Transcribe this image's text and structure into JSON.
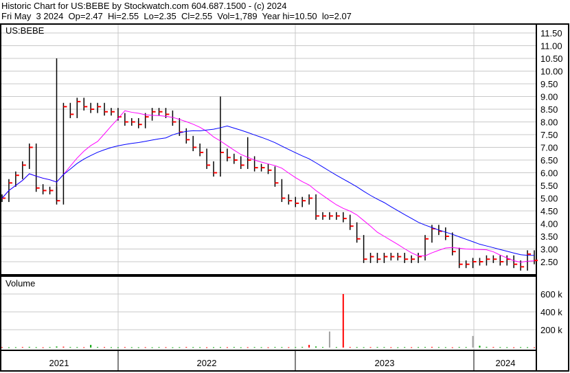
{
  "header": {
    "title": "Historic Chart for US:BEBE by Stockwatch.com 604.687.1500 - (c) 2024",
    "quote": "Fri May  3 2024  Op=2.47  Hi=2.55  Lo=2.35  Cl=2.55  Vol=1,789  Year hi=10.50  lo=2.07"
  },
  "chart_data": {
    "type": "line",
    "symbol": "US:BEBE",
    "volume_label": "Volume",
    "price_ticks": [
      "2.50",
      "3.00",
      "3.50",
      "4.00",
      "4.50",
      "5.00",
      "5.50",
      "6.00",
      "6.50",
      "7.00",
      "7.50",
      "8.00",
      "8.50",
      "9.00",
      "9.50",
      "10.00",
      "10.50",
      "11.00",
      "11.50"
    ],
    "volume_ticks": [
      "200 k",
      "400 k",
      "600 k"
    ],
    "years": [
      "2021",
      "2022",
      "2023",
      "2024"
    ],
    "ylim": [
      2.5,
      11.5
    ],
    "closes": [
      5.0,
      5.6,
      5.9,
      6.3,
      7.0,
      5.4,
      5.3,
      5.3,
      4.9,
      8.6,
      8.3,
      8.8,
      8.6,
      8.5,
      8.6,
      8.4,
      8.4,
      8.2,
      8.0,
      8.0,
      7.9,
      8.2,
      8.4,
      8.4,
      8.3,
      8.0,
      7.6,
      7.3,
      7.0,
      6.8,
      6.3,
      6.0,
      6.8,
      6.6,
      6.5,
      6.3,
      6.5,
      6.2,
      6.2,
      6.1,
      5.6,
      5.0,
      4.9,
      4.8,
      4.9,
      5.0,
      4.3,
      4.3,
      4.3,
      4.3,
      4.2,
      3.9,
      3.4,
      2.6,
      2.7,
      2.6,
      2.7,
      2.7,
      2.7,
      2.6,
      2.6,
      2.7,
      3.4,
      3.8,
      3.7,
      3.5,
      2.9,
      2.4,
      2.4,
      2.5,
      2.5,
      2.6,
      2.6,
      2.5,
      2.6,
      2.4,
      2.3,
      2.8,
      2.55
    ],
    "spikes": [
      {
        "i": 8,
        "high": 10.5
      },
      {
        "i": 32,
        "high": 9.0
      },
      {
        "i": 36,
        "high": 7.4
      }
    ],
    "volume_k": [
      5,
      3,
      4,
      6,
      8,
      4,
      3,
      5,
      12,
      10,
      6,
      5,
      4,
      30,
      6,
      5,
      4,
      3,
      5,
      4,
      3,
      4,
      3,
      5,
      4,
      3,
      4,
      6,
      5,
      4,
      3,
      4,
      5,
      4,
      6,
      3,
      4,
      5,
      4,
      3,
      6,
      5,
      4,
      5,
      8,
      30,
      12,
      6,
      180,
      5,
      600,
      6,
      5,
      4,
      5,
      6,
      5,
      4,
      3,
      5,
      4,
      5,
      6,
      8,
      5,
      4,
      3,
      6,
      5,
      130,
      20,
      8,
      6,
      5,
      4,
      3,
      5,
      4,
      3
    ],
    "ma_short": 10,
    "ma_long": 25,
    "colors": {
      "bar": "#000000",
      "close": "#ff0000",
      "ma_short": "#ff00ff",
      "ma_long": "#0000ff",
      "grid": "#c8c8c8"
    }
  }
}
